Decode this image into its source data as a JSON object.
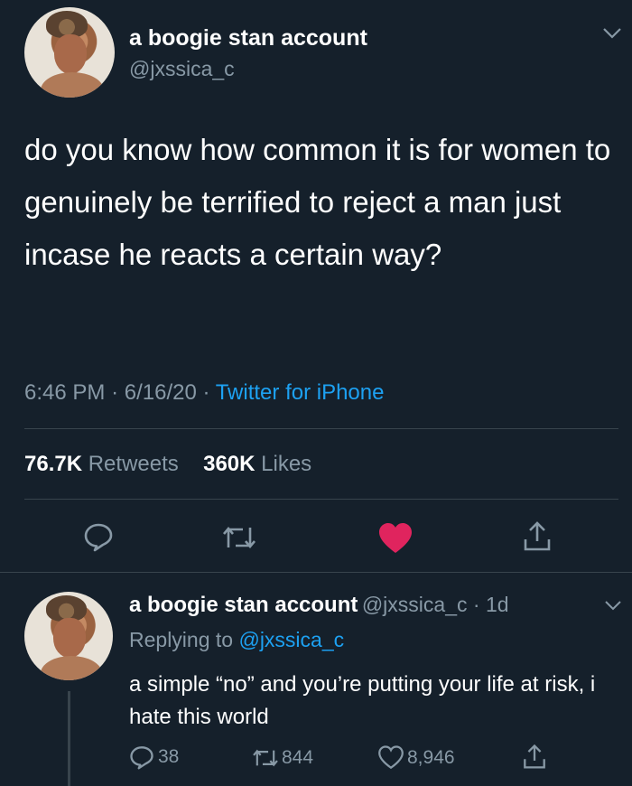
{
  "colors": {
    "background": "#15202b",
    "text": "#ffffff",
    "secondary": "#8899a6",
    "link": "#1da1f2",
    "like": "#e0245e",
    "divider": "#38444d"
  },
  "tweet": {
    "author_name": "a boogie stan account",
    "author_handle": "@jxssica_c",
    "text": "do you know how common it is for women to genuinely be terrified to reject a man just incase he reacts a certain way?",
    "time": "6:46 PM",
    "date": "6/16/20",
    "source": "Twitter for iPhone",
    "retweets_count": "76.7K",
    "retweets_label": "Retweets",
    "likes_count": "360K",
    "likes_label": "Likes",
    "icons": [
      "reply-icon",
      "retweet-icon",
      "heart-icon",
      "share-icon",
      "chevron-down-icon"
    ]
  },
  "reply": {
    "author_name": "a boogie stan account",
    "author_handle": "@jxssica_c",
    "age": "1d",
    "replying_label": "Replying to",
    "replying_handle": "@jxssica_c",
    "text": "a simple “no” and you’re putting your life at risk, i hate this world",
    "replies": "38",
    "retweets": "844",
    "likes": "8,946"
  }
}
